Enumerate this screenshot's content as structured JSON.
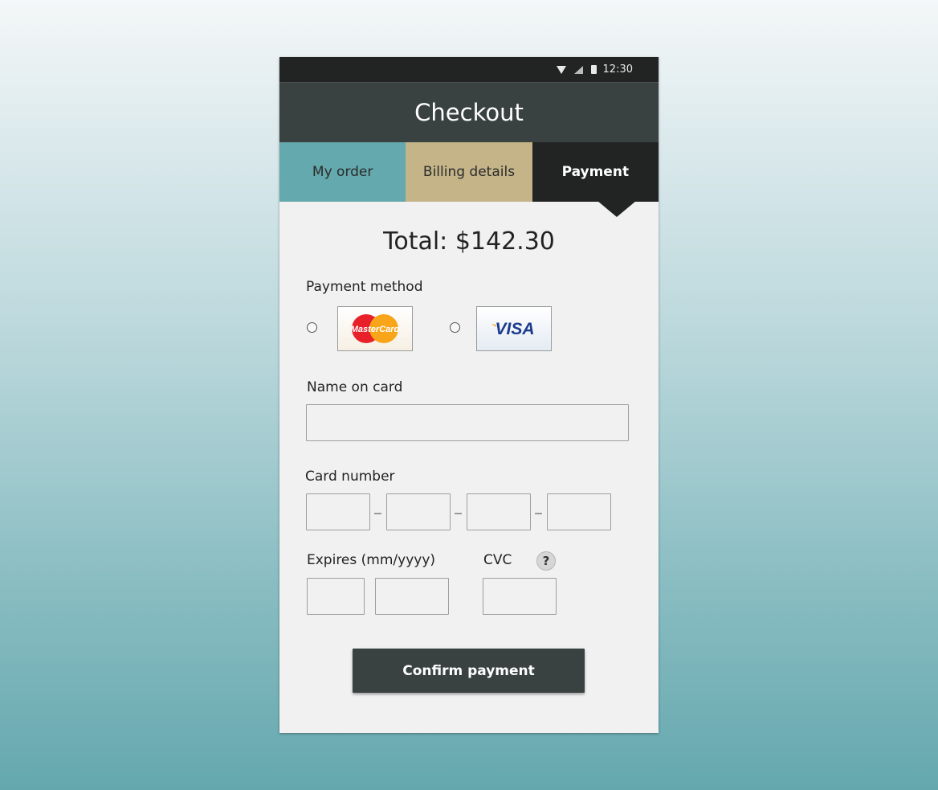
{
  "status_bar": {
    "time": "12:30"
  },
  "header": {
    "title": "Checkout"
  },
  "tabs": [
    {
      "label": "My order"
    },
    {
      "label": "Billing details"
    },
    {
      "label": "Payment"
    }
  ],
  "total": {
    "text": "Total: $142.30"
  },
  "payment_method": {
    "label": "Payment method",
    "options": [
      {
        "name": "MasterCard",
        "logo_text": "MasterCard"
      },
      {
        "name": "Visa",
        "logo_text": "VISA"
      }
    ]
  },
  "name_on_card": {
    "label": "Name on card",
    "value": ""
  },
  "card_number": {
    "label": "Card number",
    "groups": [
      "",
      "",
      "",
      ""
    ]
  },
  "expires": {
    "label": "Expires (mm/yyyy)"
  },
  "cvc": {
    "label": "CVC",
    "help": "?"
  },
  "confirm_button": {
    "label": "Confirm payment"
  },
  "colors": {
    "header_bg": "#3a4241",
    "tab_order": "#64a9ad",
    "tab_billing": "#c4b488",
    "tab_payment": "#222323"
  }
}
